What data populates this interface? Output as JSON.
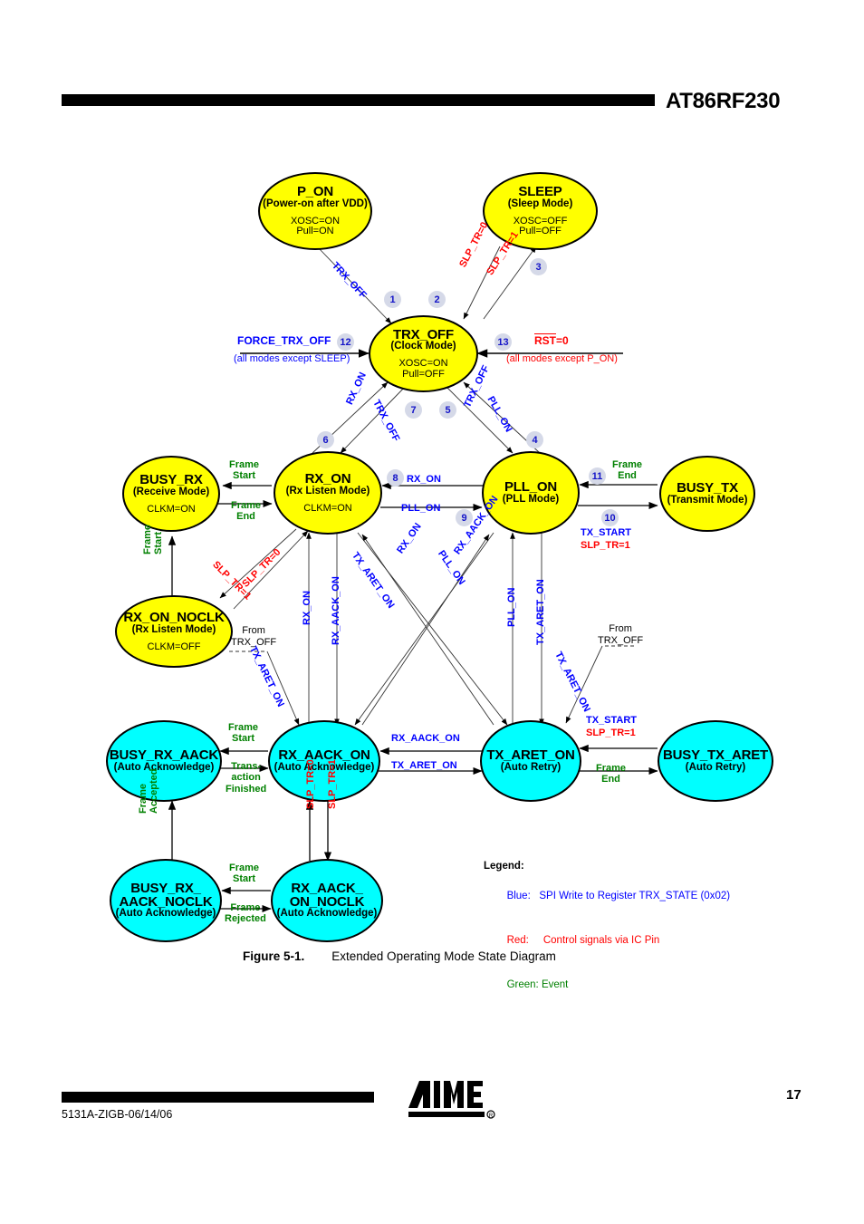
{
  "header": {
    "title": "AT86RF230"
  },
  "footer": {
    "doc_code": "5131A-ZIGB-06/14/06",
    "page_number": "17",
    "logo": "atmel-logo"
  },
  "caption": {
    "number": "Figure 5-1.",
    "text": "Extended Operating Mode State Diagram"
  },
  "legend": {
    "title": "Legend:",
    "rows": [
      {
        "key": "Blue:",
        "text": "SPI Write to Register TRX_STATE (0x02)",
        "color": "#0000ff"
      },
      {
        "key": "Red:",
        "text": "Control signals via IC Pin",
        "color": "#ff0000"
      },
      {
        "key": "Green:",
        "text": "Event",
        "color": "#008000"
      }
    ]
  },
  "colors": {
    "basic_state_fill": "#ffff00",
    "extended_state_fill": "#00ffff",
    "spi_write": "#0000ff",
    "control_pin": "#ff0000",
    "event": "#008000",
    "badge_fill": "#d5d9e8",
    "badge_text": "#1414c8"
  },
  "states": [
    {
      "id": "p_on",
      "name": "P_ON",
      "name2": "",
      "mode": "(Power-on after VDD)",
      "attrs": "XOSC=ON\nPull=ON",
      "fill": "yellow"
    },
    {
      "id": "sleep",
      "name": "SLEEP",
      "name2": "",
      "mode": "(Sleep Mode)",
      "attrs": "XOSC=OFF\nPull=OFF",
      "fill": "yellow"
    },
    {
      "id": "trx_off",
      "name": "TRX_OFF",
      "name2": "",
      "mode": "(Clock Mode)",
      "attrs": "XOSC=ON\nPull=OFF",
      "fill": "yellow"
    },
    {
      "id": "busy_rx",
      "name": "BUSY_RX",
      "name2": "",
      "mode": "(Receive Mode)",
      "attrs": "CLKM=ON",
      "fill": "yellow"
    },
    {
      "id": "rx_on",
      "name": "RX_ON",
      "name2": "",
      "mode": "(Rx Listen Mode)",
      "attrs": "CLKM=ON",
      "fill": "yellow"
    },
    {
      "id": "pll_on",
      "name": "PLL_ON",
      "name2": "",
      "mode": "(PLL Mode)",
      "attrs": "",
      "fill": "yellow"
    },
    {
      "id": "busy_tx",
      "name": "BUSY_TX",
      "name2": "",
      "mode": "(Transmit Mode)",
      "attrs": "",
      "fill": "yellow"
    },
    {
      "id": "rx_on_noclk",
      "name": "RX_ON_NOCLK",
      "name2": "",
      "mode": "(Rx Listen Mode)",
      "attrs": "CLKM=OFF",
      "fill": "yellow"
    },
    {
      "id": "busy_rx_aack",
      "name": "BUSY_RX_AACK",
      "name2": "",
      "mode": "(Auto Acknowledge)",
      "attrs": "",
      "fill": "cyan"
    },
    {
      "id": "rx_aack_on",
      "name": "RX_AACK_ON",
      "name2": "",
      "mode": "(Auto Acknowledge)",
      "attrs": "",
      "fill": "cyan"
    },
    {
      "id": "tx_aret_on",
      "name": "TX_ARET_ON",
      "name2": "",
      "mode": "(Auto Retry)",
      "attrs": "",
      "fill": "cyan"
    },
    {
      "id": "busy_tx_aret",
      "name": "BUSY_TX_ARET",
      "name2": "",
      "mode": "(Auto Retry)",
      "attrs": "",
      "fill": "cyan"
    },
    {
      "id": "busy_rx_aack_noclk",
      "name": "BUSY_RX_",
      "name2": "AACK_NOCLK",
      "mode": "(Auto Acknowledge)",
      "attrs": "",
      "fill": "cyan"
    },
    {
      "id": "rx_aack_on_noclk",
      "name": "RX_AACK_",
      "name2": "ON_NOCLK",
      "mode": "(Auto Acknowledge)",
      "attrs": "",
      "fill": "cyan"
    }
  ],
  "badges": [
    "1",
    "2",
    "3",
    "4",
    "5",
    "6",
    "7",
    "8",
    "9",
    "10",
    "11",
    "12",
    "13"
  ],
  "edge_labels": {
    "trx_off_from_pon": "TRX_OFF",
    "slp_tr_0": "SLP_TR=0",
    "slp_tr_1": "SLP_TR=1",
    "force_trx_off": "FORCE_TRX_OFF",
    "force_note": "(all modes except SLEEP)",
    "rst_0": "RST=0",
    "rst_note": "(all modes except P_ON)",
    "rx_on": "RX_ON",
    "trx_off": "TRX_OFF",
    "pll_on": "PLL_ON",
    "frame_start": "Frame\nStart",
    "frame_end": "Frame\nEnd",
    "tx_start": "TX_START",
    "slp_tr_1b": "SLP_TR=1",
    "slp_tr_1_vert": "SLP_TR=1",
    "slp_tr_0_vert": "SLP_TR=0",
    "rx_aack_on": "RX_AACK_ON",
    "tx_aret_on": "TX_ARET_ON",
    "from_trx_off": "From\nTRX_OFF",
    "transaction_finished": "Trans-\naction\nFinished",
    "frame_accepted": "Frame\nAccepted",
    "frame_rejected": "Frame\nRejected"
  }
}
